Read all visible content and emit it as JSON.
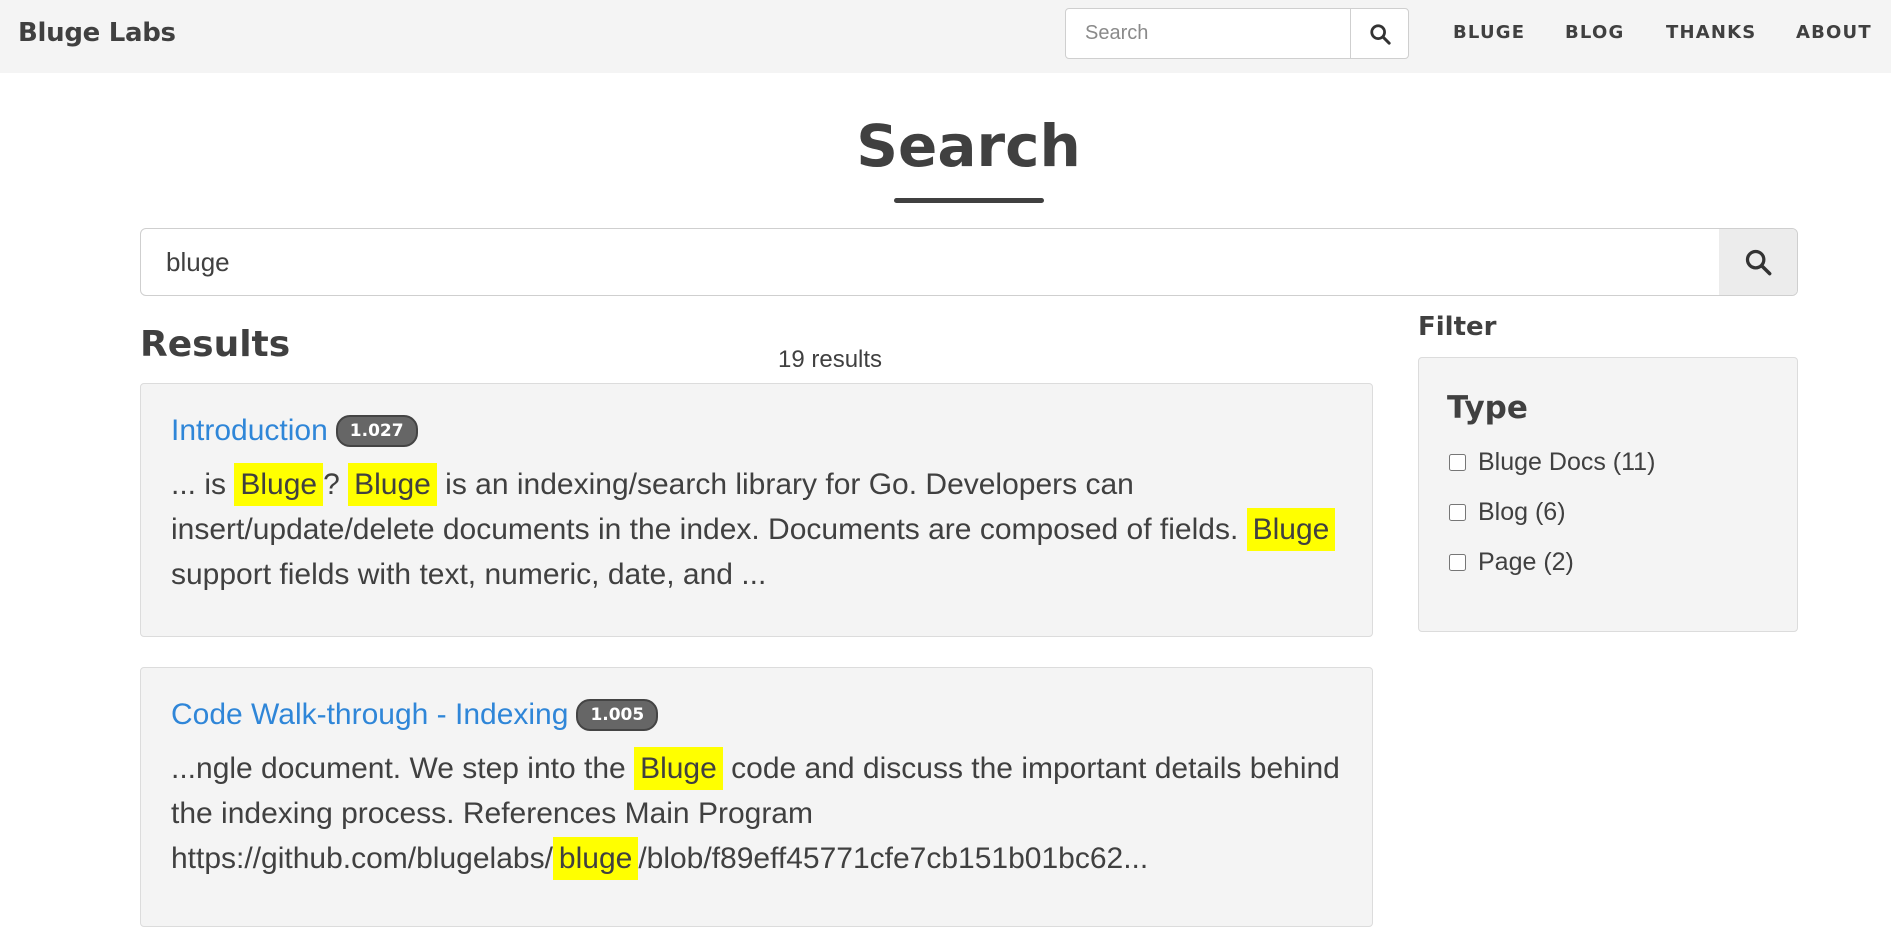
{
  "navbar": {
    "brand": "Bluge Labs",
    "search_placeholder": "Search",
    "links": [
      "BLUGE",
      "BLOG",
      "THANKS",
      "ABOUT"
    ]
  },
  "page": {
    "title": "Search",
    "search_value": "bluge"
  },
  "results": {
    "heading": "Results",
    "count_text": "19 results",
    "items": [
      {
        "title": "Introduction",
        "score": "1.027",
        "snippet": [
          {
            "t": "... is ",
            "h": false
          },
          {
            "t": "Bluge",
            "h": true
          },
          {
            "t": "? ",
            "h": false
          },
          {
            "t": "Bluge",
            "h": true
          },
          {
            "t": " is an indexing/search library for Go. Developers can insert/update/delete documents in the index. Documents are composed of fields. ",
            "h": false
          },
          {
            "t": "Bluge",
            "h": true
          },
          {
            "t": " support fields with text, numeric, date, and ...",
            "h": false
          }
        ]
      },
      {
        "title": "Code Walk-through - Indexing",
        "score": "1.005",
        "snippet": [
          {
            "t": "...ngle document. We step into the ",
            "h": false
          },
          {
            "t": "Bluge",
            "h": true
          },
          {
            "t": " code and discuss the important details behind the indexing process. References Main Program https://github.com/blugelabs/",
            "h": false
          },
          {
            "t": "bluge",
            "h": true
          },
          {
            "t": "/blob/f89eff45771cfe7cb151b01bc62...",
            "h": false
          }
        ]
      }
    ]
  },
  "filter": {
    "heading": "Filter",
    "group_title": "Type",
    "options": [
      "Bluge Docs (11)",
      "Blog (6)",
      "Page (2)"
    ]
  },
  "icons": {
    "search": "search-icon"
  },
  "colors": {
    "link": "#2f86d8",
    "highlight": "#ffff00",
    "panel": "#f4f4f4"
  }
}
